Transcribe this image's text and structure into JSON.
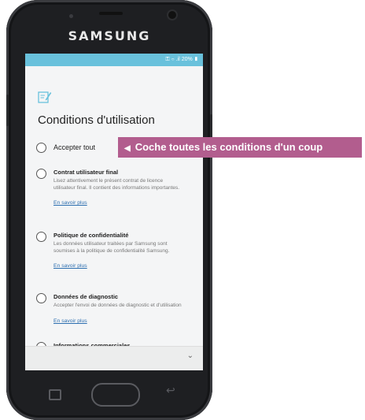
{
  "device": {
    "brand": "SAMSUNG"
  },
  "statusbar": {
    "text": "⚿ ⌔ .il 20% ▮"
  },
  "screen": {
    "title": "Conditions d'utilisation",
    "accept_all": "Accepter tout",
    "items": [
      {
        "title": "Contrat utilisateur final",
        "desc": "Lisez attentivement le présent contrat de licence utilisateur final. Il contient des informations importantes.",
        "link": "En savoir plus"
      },
      {
        "title": "Politique de confidentialité",
        "desc": "Les données utilisateur traitées par Samsung sont soumises à la politique de confidentialité Samsung.",
        "link": "En savoir plus"
      },
      {
        "title": "Données de diagnostic",
        "desc": "Accepter l'envoi de données de diagnostic et d'utilisation",
        "link": "En savoir plus"
      },
      {
        "title": "Informations commerciales"
      }
    ],
    "scroll_icon": "chevron-down-icon"
  },
  "callout": {
    "text": "Coche toutes les conditions d'un coup",
    "color": "#b25d8e"
  },
  "colors": {
    "statusbar": "#69c1dc",
    "link": "#2d6fb0"
  }
}
